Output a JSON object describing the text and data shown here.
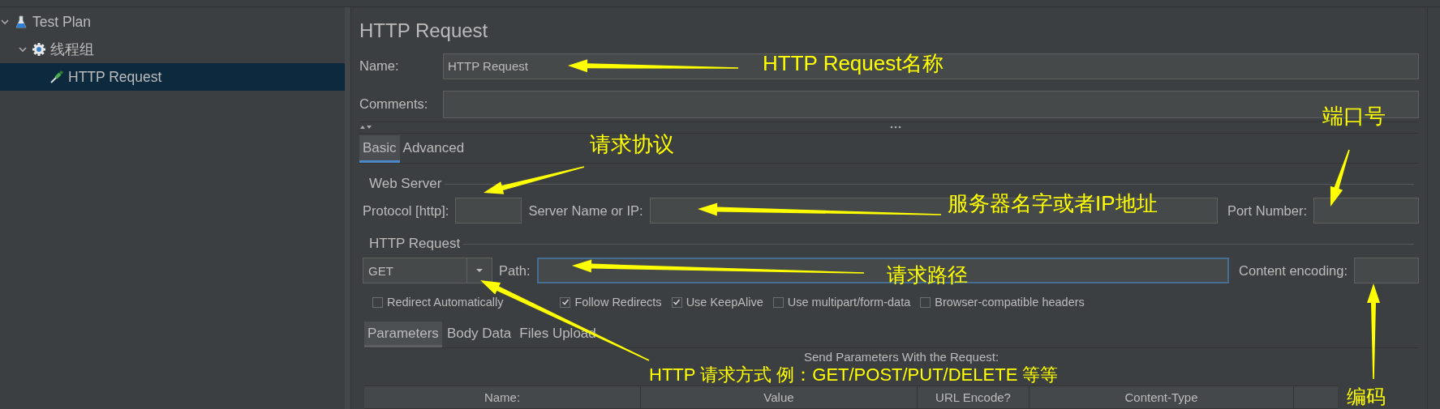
{
  "tree": [
    {
      "kind": "plan",
      "label": "Test Plan",
      "expanded": true,
      "selected": false,
      "children": [
        {
          "kind": "thread-group",
          "label": "线程组",
          "expanded": true,
          "selected": false,
          "children": [
            {
              "kind": "sampler",
              "label": "HTTP Request",
              "selected": true
            }
          ]
        }
      ]
    }
  ],
  "panel": {
    "title": "HTTP Request",
    "name_label": "Name:",
    "name_value": "HTTP Request",
    "comments_label": "Comments:",
    "tabs": [
      {
        "label": "Basic",
        "selected": true
      },
      {
        "label": "Advanced",
        "selected": false
      }
    ],
    "web_server": {
      "title": "Web Server",
      "protocol_label": "Protocol [http]:",
      "server_label": "Server Name or IP:",
      "port_label": "Port Number:"
    },
    "http_request": {
      "title": "HTTP Request",
      "method": "GET",
      "path_label": "Path:",
      "path_focused": true,
      "encoding_label": "Content encoding:"
    },
    "options": [
      {
        "label": "Redirect Automatically",
        "checked": false
      },
      {
        "label": "Follow Redirects",
        "checked": true
      },
      {
        "label": "Use KeepAlive",
        "checked": true
      },
      {
        "label": "Use multipart/form-data",
        "checked": false
      },
      {
        "label": "Browser-compatible headers",
        "checked": false
      }
    ],
    "param_tabs": [
      {
        "label": "Parameters",
        "selected": true
      },
      {
        "label": "Body Data",
        "selected": false
      },
      {
        "label": "Files Upload",
        "selected": false
      }
    ],
    "table": {
      "caption": "Send Parameters With the Request:",
      "columns": [
        "Name:",
        "Value",
        "URL Encode?",
        "Content-Type"
      ]
    }
  },
  "annotations": [
    {
      "text": "HTTP Request名称"
    },
    {
      "text": "请求协议"
    },
    {
      "text": "端口号"
    },
    {
      "text": "服务器名字或者IP地址"
    },
    {
      "text": "请求路径"
    },
    {
      "text": "HTTP 请求方式 例：GET/POST/PUT/DELETE 等等"
    },
    {
      "text": "编码"
    }
  ]
}
